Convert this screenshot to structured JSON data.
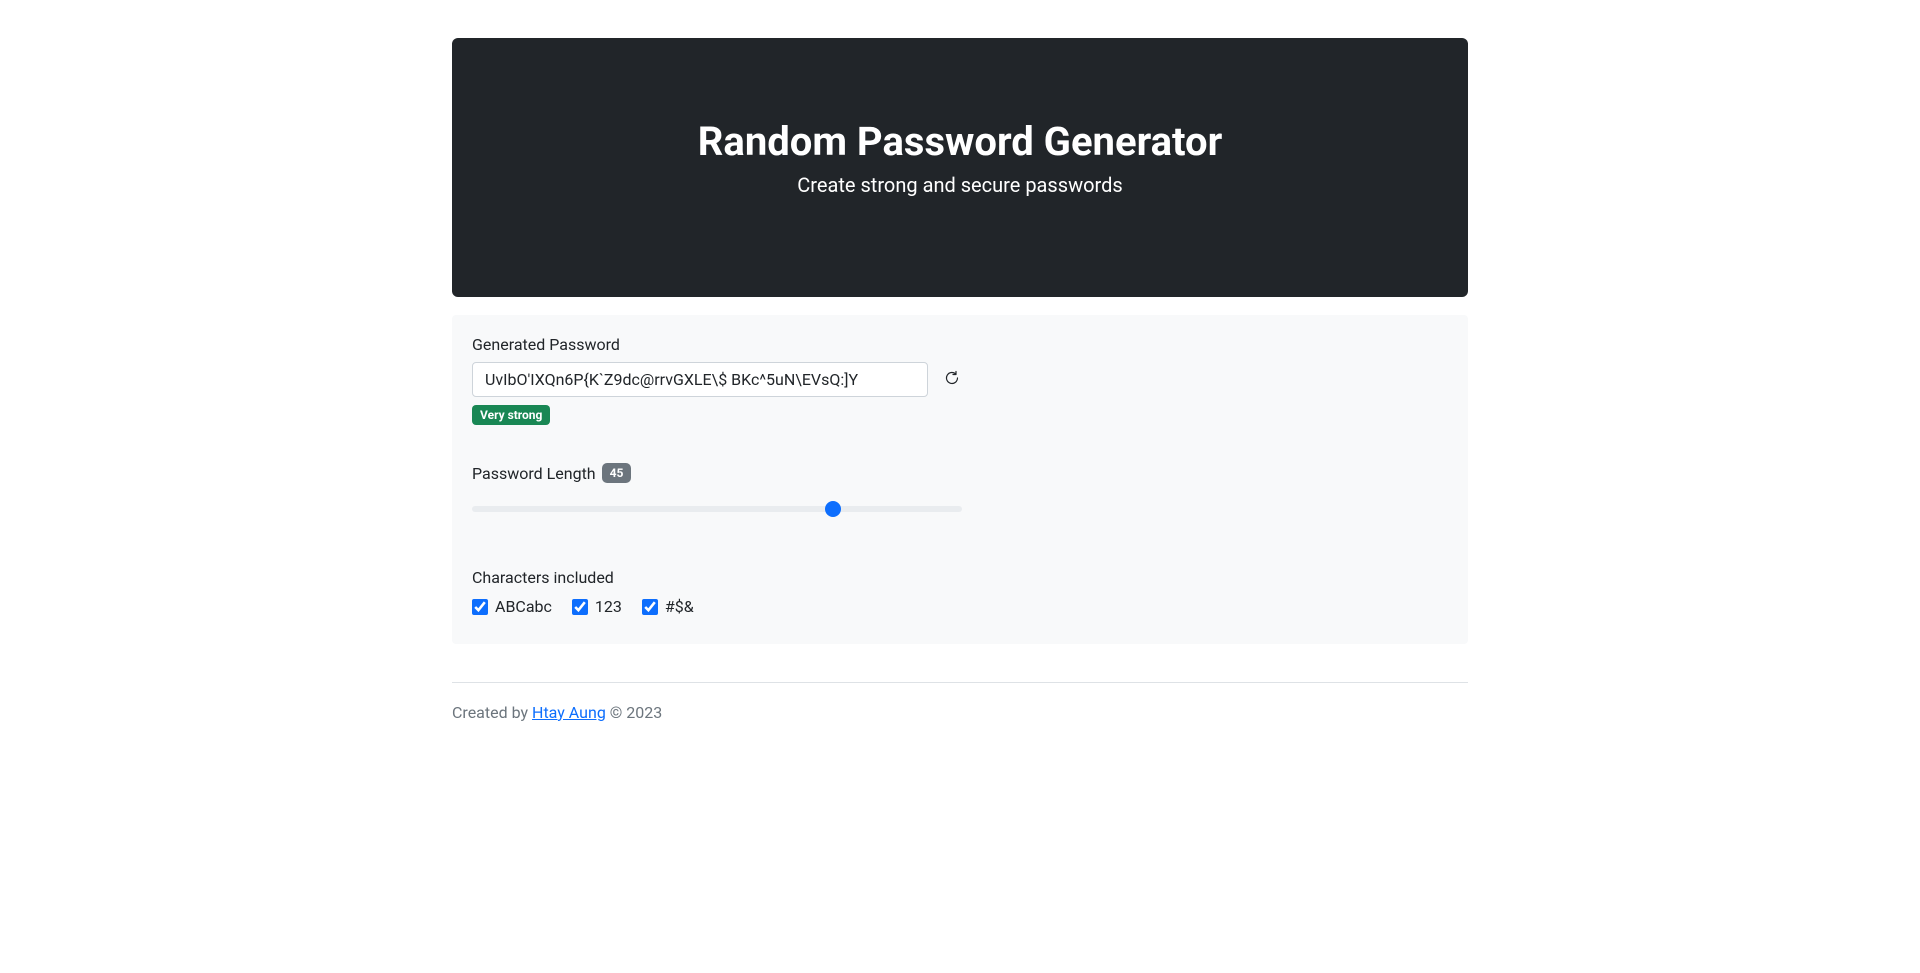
{
  "header": {
    "title": "Random Password Generator",
    "subtitle": "Create strong and secure passwords"
  },
  "generated": {
    "label": "Generated Password",
    "value": "UvIbO'IXQn6P{K`Z9dc@rrvGXLE\\$ BKc^5uN\\EVsQ:]Y",
    "strength": "Very strong"
  },
  "length": {
    "label": "Password Length",
    "value": "45",
    "min": "1",
    "max": "60"
  },
  "characters": {
    "label": "Characters included",
    "options": [
      {
        "label": "ABCabc",
        "checked": true
      },
      {
        "label": "123",
        "checked": true
      },
      {
        "label": "#$&",
        "checked": true
      }
    ]
  },
  "footer": {
    "prefix": "Created by ",
    "author": "Htay Aung",
    "suffix": " © 2023"
  }
}
